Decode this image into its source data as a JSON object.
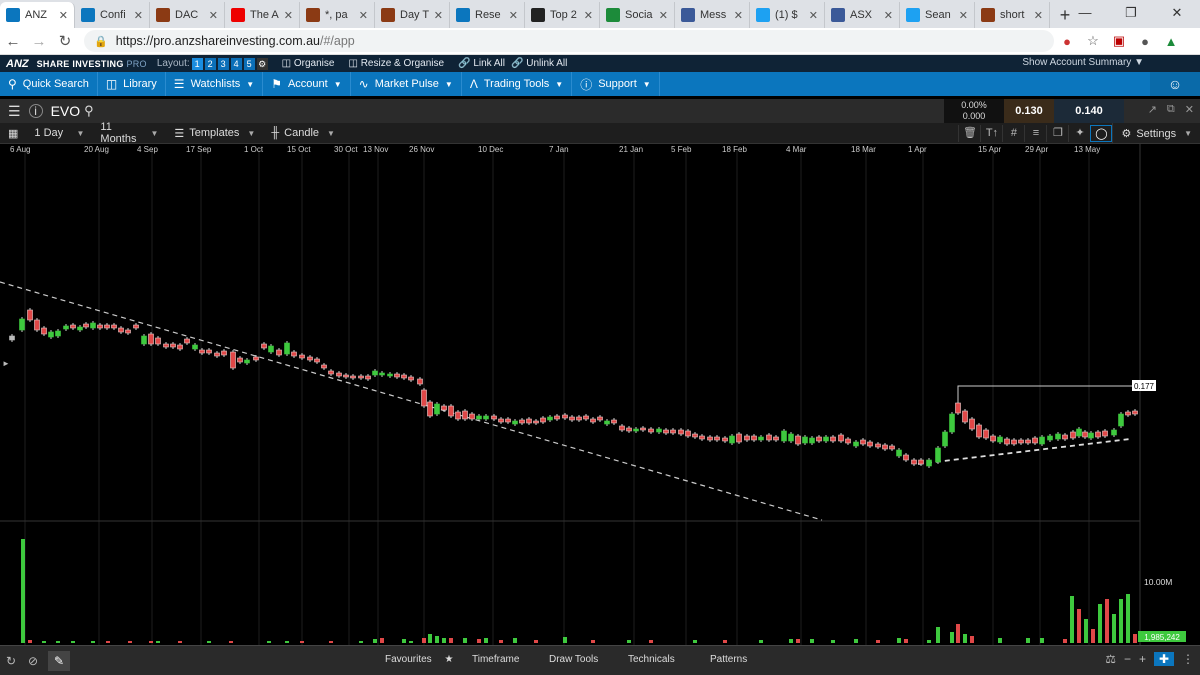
{
  "browser": {
    "tabs": [
      {
        "title": "ANZ",
        "favicon": "anz-icon",
        "color": "#0b76be",
        "active": true
      },
      {
        "title": "Confi",
        "favicon": "anz-icon",
        "color": "#0b76be"
      },
      {
        "title": "DAC",
        "favicon": "h-icon",
        "color": "#8b3a14"
      },
      {
        "title": "The A",
        "favicon": "youtube-icon",
        "color": "#e00"
      },
      {
        "title": "*, pa",
        "favicon": "h-icon",
        "color": "#8b3a14"
      },
      {
        "title": "Day T",
        "favicon": "h-icon",
        "color": "#8b3a14"
      },
      {
        "title": "Rese",
        "favicon": "anz-icon",
        "color": "#0b76be"
      },
      {
        "title": "Top 2",
        "favicon": "chart-icon",
        "color": "#222"
      },
      {
        "title": "Socia",
        "favicon": "p-icon",
        "color": "#1c8b3a"
      },
      {
        "title": "Mess",
        "favicon": "facebook-icon",
        "color": "#3b5998"
      },
      {
        "title": "(1) $",
        "favicon": "twitter-icon",
        "color": "#1da1f2"
      },
      {
        "title": "ASX",
        "favicon": "facebook-icon",
        "color": "#3b5998"
      },
      {
        "title": "Sean",
        "favicon": "twitter-icon",
        "color": "#1da1f2"
      },
      {
        "title": "short",
        "favicon": "h-icon",
        "color": "#8b3a14"
      }
    ],
    "url_host": "https://pro.anzshareinvesting.com.au",
    "url_path": "/#/app"
  },
  "anz_header": {
    "logo": "ANZ",
    "brand": "SHARE INVESTING",
    "brand_pro": "PRO",
    "layout_label": "Layout:",
    "layout_buttons": [
      "1",
      "2",
      "3",
      "4",
      "5"
    ],
    "organise": "Organise",
    "resize_organise": "Resize & Organise",
    "link_all": "Link All",
    "unlink_all": "Unlink All",
    "account_summary": "Show Account Summary"
  },
  "menu": {
    "quick_search": "Quick Search",
    "library": "Library",
    "watchlists": "Watchlists",
    "account": "Account",
    "market_pulse": "Market Pulse",
    "trading_tools": "Trading Tools",
    "support": "Support"
  },
  "panel": {
    "symbol": "EVO",
    "change_pct": "0.00%",
    "change_abs": "0.000",
    "bid": "0.130",
    "ask": "0.140"
  },
  "toolbar": {
    "interval": "1 Day",
    "range": "11 Months",
    "templates": "Templates",
    "chart_type": "Candle",
    "settings": "Settings"
  },
  "chart": {
    "date_labels": [
      "6 Aug",
      "20 Aug",
      "4 Sep",
      "17 Sep",
      "1 Oct",
      "15 Oct",
      "30 Oct",
      "13 Nov",
      "26 Nov",
      "10 Dec",
      "7 Jan",
      "21 Jan",
      "5 Feb",
      "18 Feb",
      "4 Mar",
      "18 Mar",
      "1 Apr",
      "15 Apr",
      "29 Apr",
      "13 May"
    ],
    "price_marker": "0.177",
    "volume_scale_label": "10.00M",
    "volume_current": "1,985,242",
    "up_color": "#3ec93e",
    "down_color": "#e04848"
  },
  "bottom": {
    "favourites": "Favourites",
    "timeframe": "Timeframe",
    "draw_tools": "Draw Tools",
    "technicals": "Technicals",
    "patterns": "Patterns"
  }
}
